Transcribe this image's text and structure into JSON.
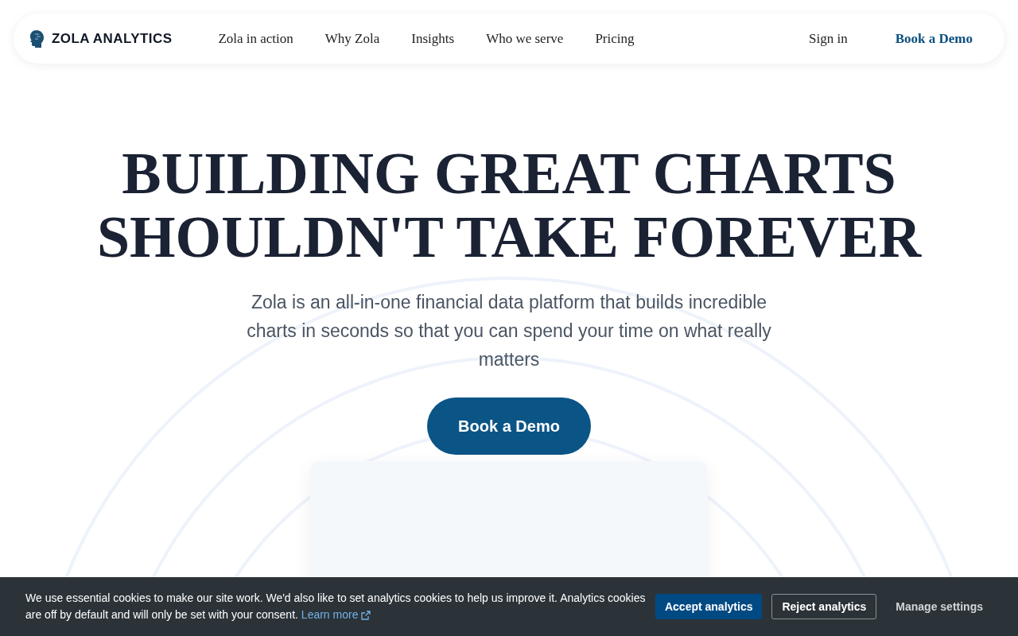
{
  "header": {
    "logo": "ZOLA ANALYTICS",
    "nav": [
      "Zola in action",
      "Why Zola",
      "Insights",
      "Who we serve",
      "Pricing"
    ],
    "sign_in": "Sign in",
    "cta": "Book a Demo"
  },
  "hero": {
    "title_lines": [
      "BUILDING GREAT CHARTS",
      "SHOULDN'T TAKE FOREVER"
    ],
    "subtitle": "Zola is an all-in-one financial data platform that builds incredible charts in seconds so that you can spend your time on what really matters",
    "cta": "Book a Demo"
  },
  "cookie_banner": {
    "text": "We use essential cookies to make our site work. We'd also like to set analytics cookies to help us improve it. Analytics cookies are off by default and will only be set with your consent.",
    "link": "Learn more",
    "accept": "Accept analytics",
    "reject": "Reject analytics",
    "manage": "Manage settings"
  }
}
